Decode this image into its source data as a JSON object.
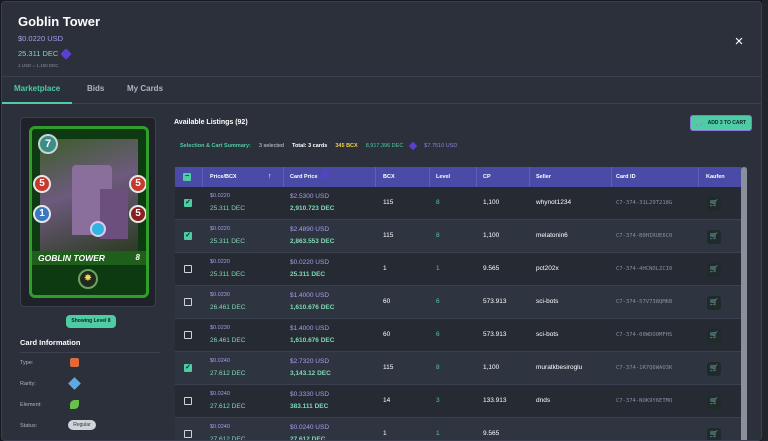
{
  "header": {
    "title": "Goblin Tower",
    "price_usd": "$0.0220 USD",
    "price_dec": "25.311 DEC",
    "rate": "1 USD = 1,150 DEC",
    "close_icon": "×"
  },
  "tabs": [
    {
      "label": "Marketplace",
      "active": true
    },
    {
      "label": "Bids",
      "active": false
    },
    {
      "label": "My Cards",
      "active": false
    }
  ],
  "card": {
    "name": "GOBLIN TOWER",
    "mana": "7",
    "attack_left": "5",
    "health_right": "5",
    "speed": "1",
    "armor": "5",
    "level_num": "8",
    "ability_icon": "✸",
    "level_badge": "Showing Level 8"
  },
  "card_info": {
    "title": "Card Information",
    "type_label": "Type:",
    "rarity_label": "Rarity:",
    "element_label": "Element:",
    "status_label": "Status:",
    "status_value": "Regular"
  },
  "listings": {
    "title": "Available Listings (92)",
    "add_button": "ADD 3 TO CART",
    "cart_icon": "🛒",
    "summary_label": "Selection & Cart Summary:",
    "summary_selected": "3 selected",
    "summary_total": "Total: 3 cards",
    "summary_bcx": "345 BCX",
    "summary_dec": "8,917.396 DEC",
    "summary_usd": "$7.7510 USD"
  },
  "columns": {
    "price_bcx": "Price/BCX",
    "card_price": "Card Price",
    "bcx": "BCX",
    "level": "Level",
    "cp": "CP",
    "seller": "Seller",
    "card_id": "Card ID",
    "kaufen": "Kaufen",
    "sort_icon": "↑"
  },
  "rows": [
    {
      "checked": true,
      "pb_usd": "$0.0220",
      "pb_dec": "25.311 DEC",
      "cp_usd": "$2.5300 USD",
      "cp_dec": "2,910.723 DEC",
      "bcx": "115",
      "level": "8",
      "cp": "1,100",
      "seller": "whynot1234",
      "card_id": "C7-374-31L29T218G"
    },
    {
      "checked": true,
      "pb_usd": "$0.0220",
      "pb_dec": "25.311 DEC",
      "cp_usd": "$2.4890 USD",
      "cp_dec": "2,863.553 DEC",
      "bcx": "115",
      "level": "8",
      "cp": "1,100",
      "seller": "melatonin6",
      "card_id": "C7-374-B0HIRUE6C0"
    },
    {
      "checked": false,
      "pb_usd": "$0.0220",
      "pb_dec": "25.311 DEC",
      "cp_usd": "$0.0220 USD",
      "cp_dec": "25.311 DEC",
      "bcx": "1",
      "level": "1",
      "cp": "9.565",
      "seller": "pct202x",
      "card_id": "C7-374-4HCNOLZCI0"
    },
    {
      "checked": false,
      "pb_usd": "$0.0230",
      "pb_dec": "26.461 DEC",
      "cp_usd": "$1.4000 USD",
      "cp_dec": "1,610.676 DEC",
      "bcx": "60",
      "level": "6",
      "cp": "573.913",
      "seller": "sci-bots",
      "card_id": "C7-374-57V738QM6B"
    },
    {
      "checked": false,
      "pb_usd": "$0.0230",
      "pb_dec": "26.461 DEC",
      "cp_usd": "$1.4000 USD",
      "cp_dec": "1,610.676 DEC",
      "bcx": "60",
      "level": "6",
      "cp": "573.913",
      "seller": "sci-bots",
      "card_id": "C7-374-00WDO0MFHS"
    },
    {
      "checked": true,
      "pb_usd": "$0.0240",
      "pb_dec": "27.612 DEC",
      "cp_usd": "$2.7320 USD",
      "cp_dec": "3,143.12 DEC",
      "bcx": "115",
      "level": "8",
      "cp": "1,100",
      "seller": "muratkbesiroglu",
      "card_id": "C7-374-1R7Q6WAO3K"
    },
    {
      "checked": false,
      "pb_usd": "$0.0240",
      "pb_dec": "27.612 DEC",
      "cp_usd": "$0.3330 USD",
      "cp_dec": "383.111 DEC",
      "bcx": "14",
      "level": "3",
      "cp": "133.913",
      "seller": "dnds",
      "card_id": "C7-374-NOK9Y6ETMO"
    },
    {
      "checked": false,
      "pb_usd": "$0.0240",
      "pb_dec": "27.612 DEC",
      "cp_usd": "$0.0240 USD",
      "cp_dec": "27.612 DEC",
      "bcx": "1",
      "level": "1",
      "cp": "9.565",
      "seller": "",
      "card_id": ""
    }
  ],
  "colors": {
    "accent": "#4ecca3",
    "header_bg": "#4a4ba6",
    "usd": "#a89ef0",
    "dec": "#7fd9b5"
  }
}
